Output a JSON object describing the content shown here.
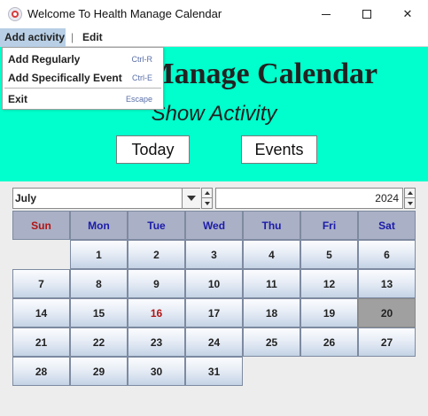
{
  "window": {
    "title": "Welcome To Health Manage Calendar",
    "icon": "app-icon",
    "controls": {
      "minimize": "minimize-icon",
      "maximize": "maximize-icon",
      "close": "✕"
    }
  },
  "menubar": {
    "items": [
      {
        "label": "Add activity",
        "open": true
      },
      {
        "label": "Edit"
      }
    ],
    "separator": "|"
  },
  "dropdown": {
    "items": [
      {
        "label": "Add Regularly",
        "accelerator": "Ctrl-R"
      },
      {
        "label": "Add Specifically Event",
        "accelerator": "Ctrl-E"
      },
      {
        "label": "Exit",
        "accelerator": "Escape"
      }
    ]
  },
  "banner": {
    "title": "Health Manage Calendar",
    "subtitle": "Show Activity",
    "today_label": "Today",
    "events_label": "Events",
    "background": "#00ffcc"
  },
  "selector": {
    "month": "July",
    "year": "2024"
  },
  "calendar": {
    "weekdays": [
      "Sun",
      "Mon",
      "Tue",
      "Wed",
      "Thu",
      "Fri",
      "Sat"
    ],
    "first_weekday_index": 1,
    "days_in_month": 31,
    "today": 16,
    "selected": 20,
    "colors": {
      "weekday_text": "#1c1ca8",
      "sunday_text": "#b01515",
      "today_text": "#b01515",
      "selected_bg": "#a0a0a0"
    }
  }
}
